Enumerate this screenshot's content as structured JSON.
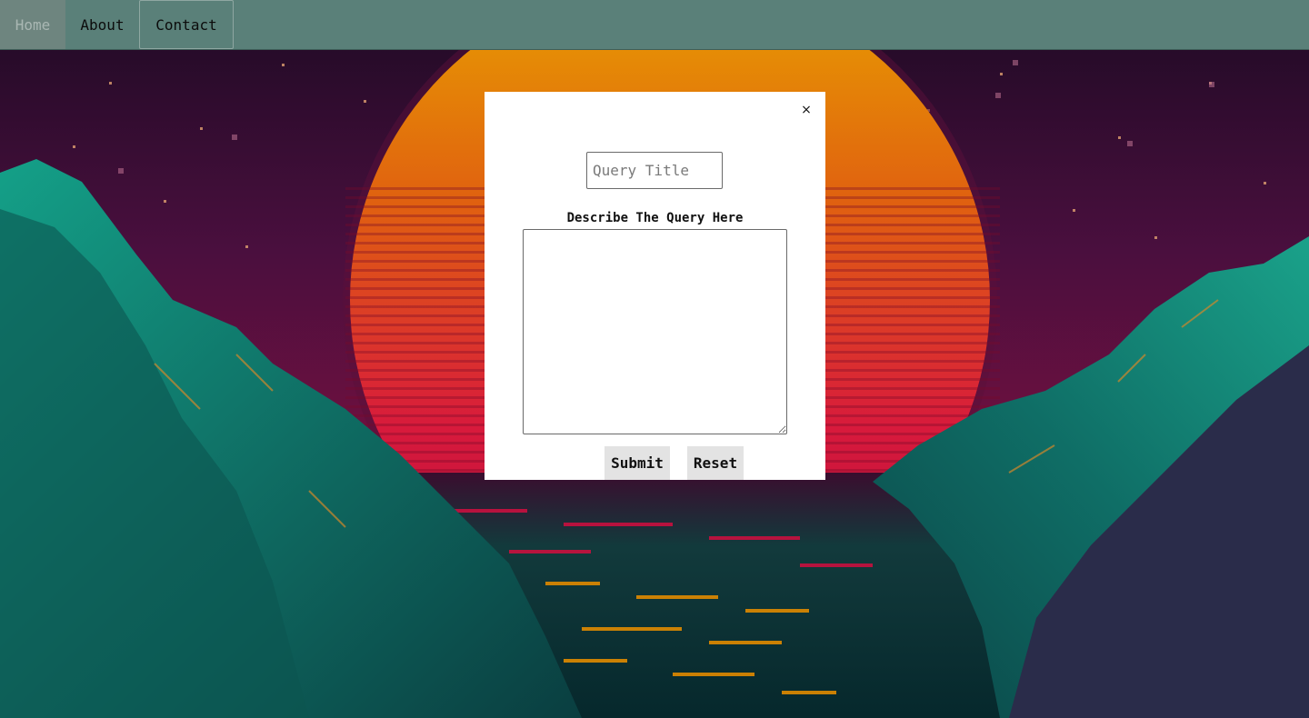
{
  "nav": {
    "items": [
      {
        "label": "Home"
      },
      {
        "label": "About"
      },
      {
        "label": "Contact"
      }
    ]
  },
  "modal": {
    "close_label": "×",
    "title_placeholder": "Query Title",
    "desc_label": "Describe The Query Here",
    "submit_label": "Submit",
    "reset_label": "Reset"
  },
  "colors": {
    "nav_bg": "#5a8079",
    "sky": "#3a0f38",
    "sun_top": "#e08a00",
    "sun_bottom": "#c8103f",
    "mountain": "#0f7d70",
    "water": "#0d3a3a"
  }
}
